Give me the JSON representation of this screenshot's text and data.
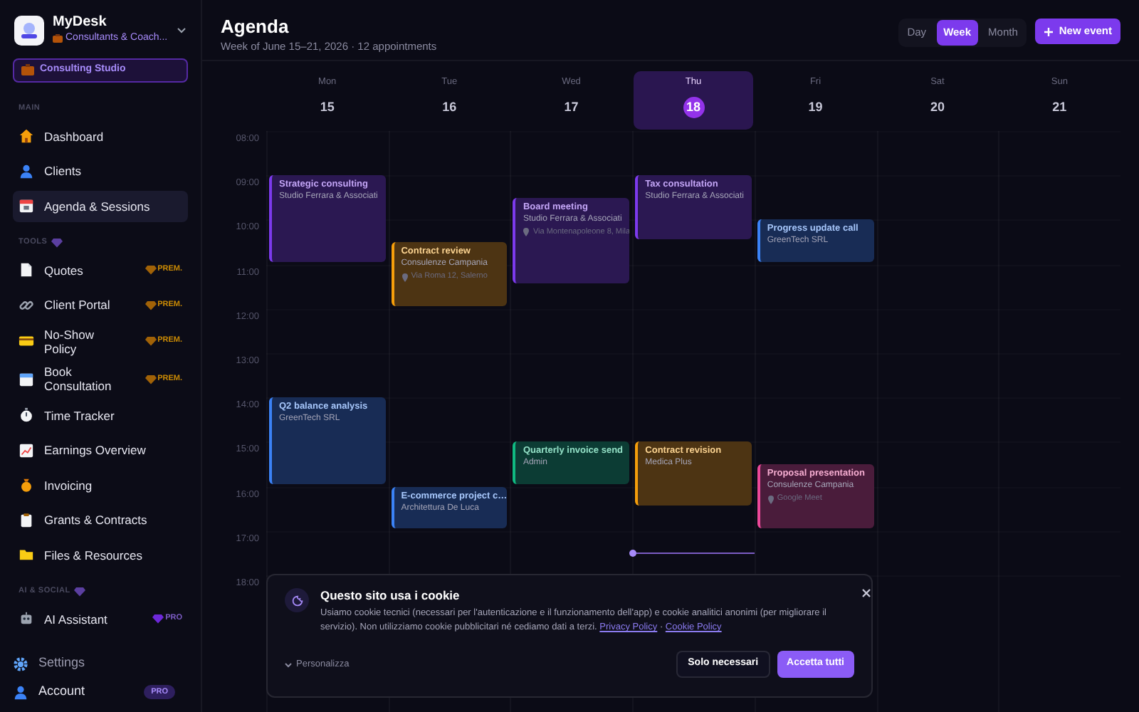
{
  "sidebar": {
    "app": {
      "title": "MyDesk",
      "subtitle": "Consultants & Coach..."
    },
    "workspace": "Consulting Studio",
    "sections": [
      {
        "label": "MAIN",
        "marked": false,
        "items": [
          {
            "label": "Dashboard",
            "selected": false
          },
          {
            "label": "Clients",
            "selected": false
          },
          {
            "label": "Agenda & Sessions",
            "selected": true
          }
        ]
      },
      {
        "label": "TOOLS",
        "marked": true,
        "items": [
          {
            "label": "Quotes",
            "selected": false,
            "badge": {
              "text": "PREM.",
              "kind": "premium"
            }
          },
          {
            "label": "Client Portal",
            "selected": false,
            "badge": {
              "text": "PREM.",
              "kind": "premium"
            }
          },
          {
            "label": "No-Show Policy",
            "selected": false,
            "badge": {
              "text": "PREM.",
              "kind": "premium"
            }
          },
          {
            "label": "Book Consultation",
            "selected": false,
            "badge": {
              "text": "PREM.",
              "kind": "premium"
            }
          },
          {
            "label": "Time Tracker",
            "selected": false
          },
          {
            "label": "Earnings Overview",
            "selected": false
          },
          {
            "label": "Invoicing",
            "selected": false
          },
          {
            "label": "Grants & Contracts",
            "selected": false
          },
          {
            "label": "Files & Resources",
            "selected": false
          }
        ]
      },
      {
        "label": "AI & SOCIAL",
        "marked": true,
        "items": [
          {
            "label": "AI Assistant",
            "selected": false,
            "badge": {
              "text": "PRO",
              "kind": "pro"
            }
          }
        ]
      }
    ],
    "footer": [
      {
        "label": "Settings"
      },
      {
        "label": "Account",
        "badge": {
          "text": "PRO",
          "kind": "pill"
        }
      }
    ]
  },
  "header": {
    "title": "Agenda",
    "subtitle": "Week of June 15–21, 2026 · 12 appointments",
    "views": [
      {
        "label": "Day",
        "selected": false
      },
      {
        "label": "Week",
        "selected": true
      },
      {
        "label": "Month",
        "selected": false
      }
    ],
    "new_event": "New event"
  },
  "calendar": {
    "hours": [
      "08:00",
      "09:00",
      "10:00",
      "11:00",
      "12:00",
      "13:00",
      "14:00",
      "15:00",
      "16:00",
      "17:00",
      "18:00"
    ],
    "days": [
      {
        "name": "Mon",
        "date": "15",
        "selected": false,
        "events": [
          {
            "title": "Strategic consulting",
            "client": "Studio Ferrara & Associati",
            "color": "#7c3aed"
          },
          {
            "title": "Q2 balance analysis",
            "client": "GreenTech SRL",
            "color": "#3b82f6"
          }
        ]
      },
      {
        "name": "Tue",
        "date": "16",
        "selected": false,
        "events": [
          {
            "title": "Contract review",
            "client": "Consulenze Campania",
            "location": "Via Roma 12, Salerno",
            "color": "#f59e0b"
          },
          {
            "title": "E-commerce project c…",
            "client": "Architettura De Luca",
            "color": "#3b82f6"
          }
        ]
      },
      {
        "name": "Wed",
        "date": "17",
        "selected": false,
        "events": [
          {
            "title": "Board meeting",
            "client": "Studio Ferrara & Associati",
            "location": "Via Montenapoleone 8, Mila",
            "color": "#7c3aed"
          },
          {
            "title": "Quarterly invoice send",
            "client": "Admin",
            "color": "#10b981"
          }
        ]
      },
      {
        "name": "Thu",
        "date": "18",
        "selected": true,
        "events": [
          {
            "title": "Tax consultation",
            "client": "Studio Ferrara & Associati",
            "color": "#7c3aed"
          },
          {
            "title": "Contract revision",
            "client": "Medica Plus",
            "color": "#f59e0b"
          }
        ]
      },
      {
        "name": "Fri",
        "date": "19",
        "selected": false,
        "events": [
          {
            "title": "Progress update call",
            "client": "GreenTech SRL",
            "color": "#3b82f6"
          },
          {
            "title": "Proposal presentation",
            "client": "Consulenze Campania",
            "location": "Google Meet",
            "color": "#ec4899"
          }
        ]
      },
      {
        "name": "Sat",
        "date": "20",
        "selected": false
      },
      {
        "name": "Sun",
        "date": "21",
        "selected": false
      }
    ]
  },
  "cookie_banner": {
    "title": "Questo sito usa i cookie",
    "text": "Usiamo cookie tecnici (necessari per l'autenticazione e il funzionamento dell'app) e cookie analitici anonimi (per migliorare il servizio). Non utilizziamo cookie pubblicitari né cediamo dati a terzi.",
    "links": [
      "Privacy Policy",
      "Cookie Policy"
    ],
    "separator": "·",
    "customize": "Personalizza",
    "buttons": [
      {
        "label": "Solo necessari",
        "kind": "secondary"
      },
      {
        "label": "Accetta tutti",
        "kind": "primary"
      }
    ]
  }
}
